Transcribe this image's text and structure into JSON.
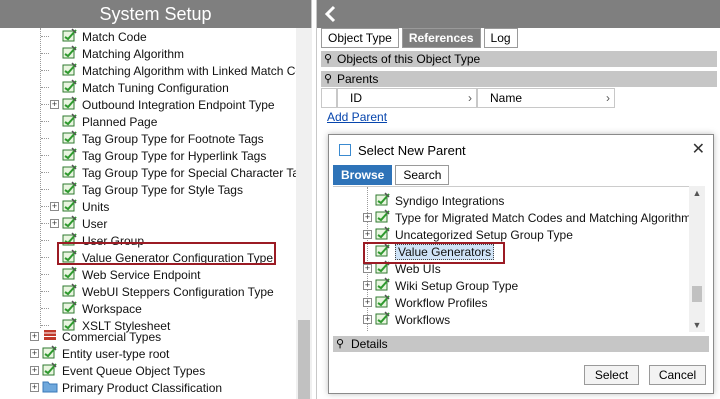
{
  "left_panel": {
    "title": "System Setup",
    "tree": [
      {
        "label": "Match Code",
        "expandable": false
      },
      {
        "label": "Matching Algorithm",
        "expandable": false
      },
      {
        "label": "Matching Algorithm with Linked Match Code",
        "expandable": false
      },
      {
        "label": "Match Tuning Configuration",
        "expandable": false
      },
      {
        "label": "Outbound Integration Endpoint Type",
        "expandable": true
      },
      {
        "label": "Planned Page",
        "expandable": false
      },
      {
        "label": "Tag Group Type for Footnote Tags",
        "expandable": false
      },
      {
        "label": "Tag Group Type for Hyperlink Tags",
        "expandable": false
      },
      {
        "label": "Tag Group Type for Special Character Tags",
        "expandable": false
      },
      {
        "label": "Tag Group Type for Style Tags",
        "expandable": false
      },
      {
        "label": "Units",
        "expandable": true
      },
      {
        "label": "User",
        "expandable": true
      },
      {
        "label": "User Group",
        "expandable": false
      },
      {
        "label": "Value Generator Configuration Type",
        "expandable": false,
        "highlighted": true
      },
      {
        "label": "Web Service Endpoint",
        "expandable": false
      },
      {
        "label": "WebUI Steppers Configuration Type",
        "expandable": false
      },
      {
        "label": "Workspace",
        "expandable": false
      },
      {
        "label": "XSLT Stylesheet",
        "expandable": false
      }
    ],
    "root_items": [
      {
        "label": "Commercial Types",
        "icon": "red-db-icon"
      },
      {
        "label": "Entity user-type root",
        "icon": "green-edit-icon"
      },
      {
        "label": "Event Queue Object Types",
        "icon": "green-edit-icon"
      },
      {
        "label": "Primary Product Classification",
        "icon": "blue-folder-icon"
      }
    ]
  },
  "right_panel": {
    "back_icon": "chevron-left-icon",
    "tabs": [
      {
        "label": "Object Type",
        "style": "light"
      },
      {
        "label": "References",
        "style": "dark"
      },
      {
        "label": "Log",
        "style": "light"
      }
    ],
    "objects_section": "Objects of this  Object Type",
    "parents_section": "Parents",
    "grid_columns": [
      "ID",
      "Name"
    ],
    "add_parent": "Add Parent"
  },
  "dialog": {
    "title": "Select New Parent",
    "tabs": [
      "Browse",
      "Search"
    ],
    "tree": [
      {
        "label": "Syndigo Integrations",
        "expandable": false
      },
      {
        "label": "Type for Migrated Match Codes and Matching Algorithms",
        "expandable": true
      },
      {
        "label": "Uncategorized Setup Group Type",
        "expandable": true
      },
      {
        "label": "Value Generators",
        "expandable": false,
        "selected": true
      },
      {
        "label": "Web UIs",
        "expandable": true
      },
      {
        "label": "Wiki Setup Group Type",
        "expandable": true
      },
      {
        "label": "Workflow Profiles",
        "expandable": true
      },
      {
        "label": "Workflows",
        "expandable": true
      }
    ],
    "details_label": "Details",
    "select_button": "Select",
    "cancel_button": "Cancel"
  },
  "colors": {
    "header_gray": "#7f7f7f",
    "section_gray": "#c6c6c6",
    "highlight_red": "#9b1b24",
    "browse_blue": "#2e73b8",
    "link_blue": "#0645ad"
  }
}
